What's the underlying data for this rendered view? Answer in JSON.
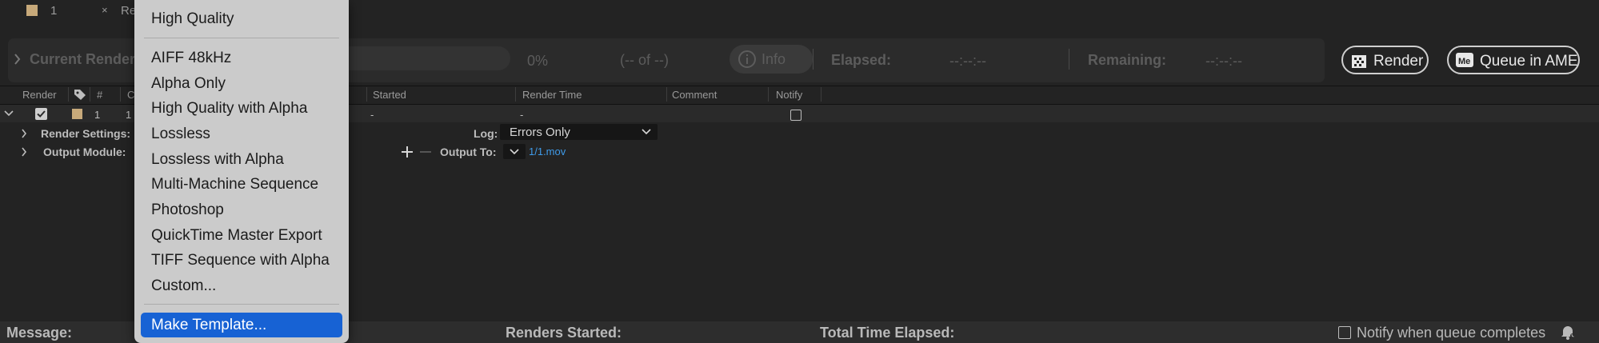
{
  "tabs": [
    {
      "label": "1"
    },
    {
      "label": "Re"
    }
  ],
  "colors": {
    "accent": "#1762d4",
    "swatch": "#c7a97a",
    "link": "#3f9bea"
  },
  "status": {
    "current_render_label": "Current Render",
    "percent": "0%",
    "count": "(-- of --)",
    "info_label": "Info",
    "elapsed_label": "Elapsed:",
    "elapsed_value": "--:--:--",
    "remaining_label": "Remaining:",
    "remaining_value": "--:--:--",
    "render_button": "Render",
    "ame_button": "Queue in AME",
    "progress_fraction": 0
  },
  "columns": {
    "render": "Render",
    "num": "#",
    "comp": "C",
    "started": "Started",
    "render_time": "Render Time",
    "comment": "Comment",
    "notify": "Notify"
  },
  "queue_item": {
    "checked": true,
    "num": "1",
    "comp_short": "1",
    "started": "-",
    "render_time": "-",
    "render_settings_label": "Render Settings:",
    "output_module_label": "Output Module:",
    "log_label": "Log:",
    "log_value": "Errors Only",
    "output_to_label": "Output To:",
    "output_file": "1/1.mov"
  },
  "footer": {
    "message_label": "Message:",
    "renders_started_label": "Renders Started:",
    "total_time_label": "Total Time Elapsed:",
    "notify_label": "Notify when queue completes"
  },
  "menu": {
    "top_item": "High Quality",
    "items": [
      "AIFF 48kHz",
      "Alpha Only",
      "High Quality with Alpha",
      "Lossless",
      "Lossless with Alpha",
      "Multi-Machine Sequence",
      "Photoshop",
      "QuickTime Master Export",
      "TIFF Sequence with Alpha",
      "Custom..."
    ],
    "highlighted_item": "Make Template..."
  }
}
